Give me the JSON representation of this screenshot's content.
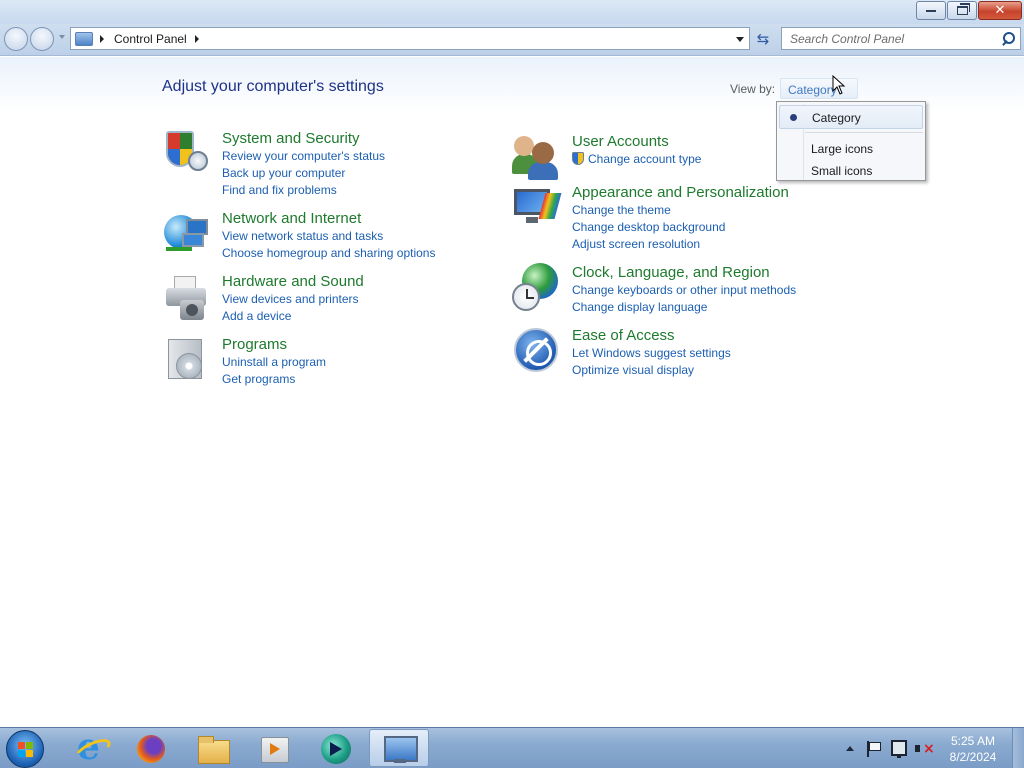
{
  "window": {
    "caption_buttons": [
      "minimize",
      "restore",
      "close"
    ]
  },
  "navigation": {
    "breadcrumb": [
      "Control Panel"
    ],
    "search": {
      "placeholder": "Search Control Panel",
      "value": ""
    }
  },
  "header": {
    "title": "Adjust your computer's settings",
    "view_by_label": "View by:",
    "view_by_value": "Category"
  },
  "view_menu": {
    "items": [
      {
        "label": "Category",
        "selected": true
      },
      {
        "label": "Large icons",
        "selected": false
      },
      {
        "label": "Small icons",
        "selected": false
      }
    ]
  },
  "categories": [
    {
      "title": "System and Security",
      "icon": "shield-icon",
      "links": [
        "Review your computer's status",
        "Back up your computer",
        "Find and fix problems"
      ]
    },
    {
      "title": "Network and Internet",
      "icon": "network-icon",
      "links": [
        "View network status and tasks",
        "Choose homegroup and sharing options"
      ]
    },
    {
      "title": "Hardware and Sound",
      "icon": "printer-speaker-icon",
      "links": [
        "View devices and printers",
        "Add a device"
      ]
    },
    {
      "title": "Programs",
      "icon": "programs-disc-icon",
      "links": [
        "Uninstall a program",
        "Get programs"
      ]
    },
    {
      "title": "User Accounts",
      "icon": "users-icon",
      "links": [
        "Change account type"
      ]
    },
    {
      "title": "Appearance and Personalization",
      "icon": "monitor-brush-icon",
      "links": [
        "Change the theme",
        "Change desktop background",
        "Adjust screen resolution"
      ]
    },
    {
      "title": "Clock, Language, and Region",
      "icon": "globe-clock-icon",
      "links": [
        "Change keyboards or other input methods",
        "Change display language"
      ]
    },
    {
      "title": "Ease of Access",
      "icon": "accessibility-icon",
      "links": [
        "Let Windows suggest settings",
        "Optimize visual display"
      ]
    }
  ],
  "taskbar": {
    "pinned": [
      "start-orb-icon",
      "internet-explorer-icon",
      "firefox-icon",
      "windows-explorer-icon",
      "media-player-icon",
      "app-icon",
      "control-panel-icon"
    ],
    "clock": {
      "time": "5:25 AM",
      "date": "8/2/2024"
    }
  },
  "colors": {
    "category_title": "#1e7a2e",
    "link": "#1c5fb1",
    "page_title": "#1e3287"
  }
}
